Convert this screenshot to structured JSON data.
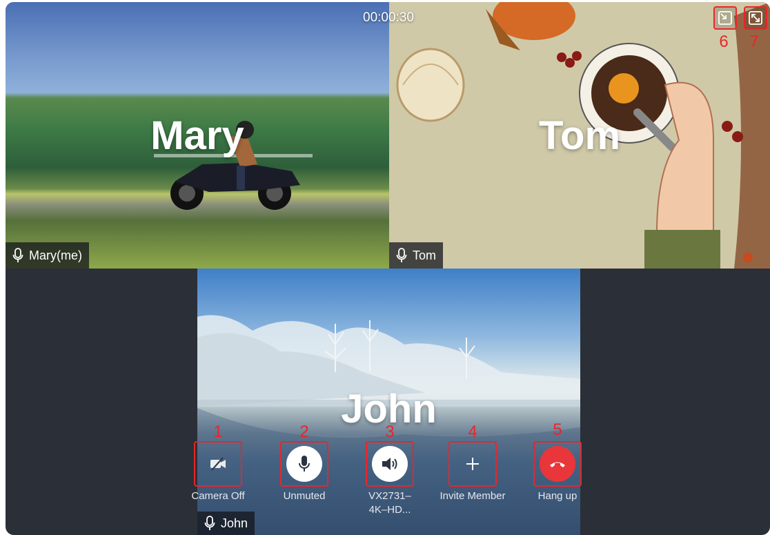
{
  "call": {
    "timer": "00:00:30"
  },
  "participants": [
    {
      "big_name": "Mary",
      "tag": "Mary(me)"
    },
    {
      "big_name": "Tom",
      "tag": "Tom"
    },
    {
      "big_name": "John",
      "tag": "John"
    }
  ],
  "controls": [
    {
      "number": "1",
      "label": "Camera Off",
      "icon": "camera-off-icon"
    },
    {
      "number": "2",
      "label": "Unmuted",
      "icon": "microphone-icon"
    },
    {
      "number": "3",
      "label_line1": "VX2731–",
      "label_line2": "4K–HD...",
      "icon": "speaker-icon"
    },
    {
      "number": "4",
      "label": "Invite Member",
      "icon": "plus-icon"
    },
    {
      "number": "5",
      "label": "Hang up",
      "icon": "hang-up-icon"
    }
  ],
  "window_controls": [
    {
      "number": "6",
      "icon": "minimize-window-icon"
    },
    {
      "number": "7",
      "icon": "fullscreen-icon"
    }
  ],
  "colors": {
    "annotation": "#e8262a",
    "hangup": "#e8363b",
    "panel": "#2b2f37"
  }
}
